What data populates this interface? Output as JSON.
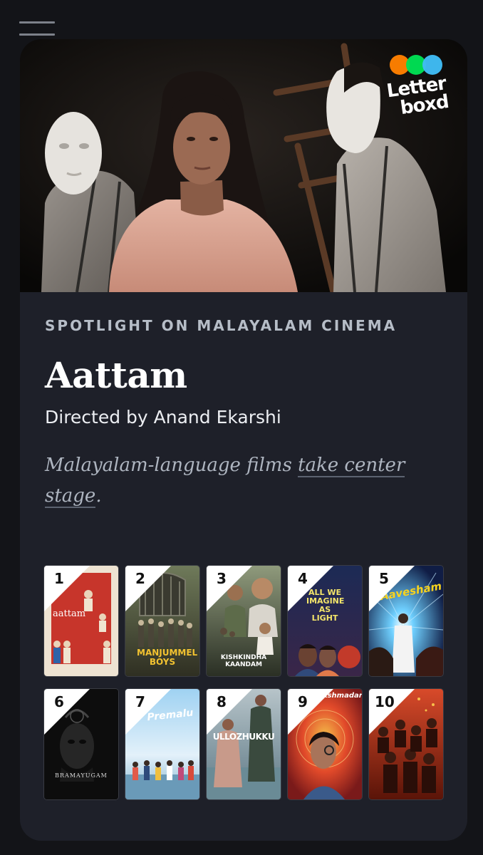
{
  "nav": {
    "menu_icon": "hamburger-menu-icon"
  },
  "brand": {
    "wordmark": "Letter\nboxd",
    "dot_colors": [
      "#ff8000",
      "#00e054",
      "#40bcf4"
    ]
  },
  "feature": {
    "eyebrow": "SPOTLIGHT ON MALAYALAM CINEMA",
    "title": "Aattam",
    "director": "Directed by Anand Ekarshi",
    "tagline_prefix": "Malayalam-language films ",
    "tagline_link": "take center stage",
    "tagline_suffix": "."
  },
  "films": [
    {
      "rank": "1",
      "title": "aattam"
    },
    {
      "rank": "2",
      "title": "MANJUMMEL BOYS"
    },
    {
      "rank": "3",
      "title": "KISHKINDHA KAANDAM"
    },
    {
      "rank": "4",
      "title": "ALL WE IMAGINE AS LIGHT"
    },
    {
      "rank": "5",
      "title": "Aavesham"
    },
    {
      "rank": "6",
      "title": "BRAMAYUGAM"
    },
    {
      "rank": "7",
      "title": "Premalu"
    },
    {
      "rank": "8",
      "title": "ULLOZHUKKU"
    },
    {
      "rank": "9",
      "title": "Sookshmadarshini"
    },
    {
      "rank": "10",
      "title": ""
    }
  ]
}
